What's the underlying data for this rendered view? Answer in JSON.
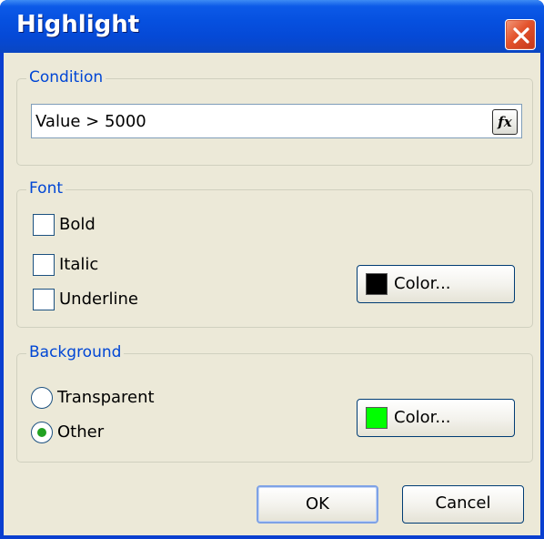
{
  "window": {
    "title": "Highlight"
  },
  "condition": {
    "legend": "Condition",
    "value": "Value > 5000",
    "fx_label": "fx"
  },
  "font": {
    "legend": "Font",
    "checkboxes": [
      {
        "label": "Bold",
        "checked": false
      },
      {
        "label": "Italic",
        "checked": false
      },
      {
        "label": "Underline",
        "checked": false
      }
    ],
    "color_button": {
      "label": "Color...",
      "swatch": "#000000"
    }
  },
  "background": {
    "legend": "Background",
    "options": [
      {
        "label": "Transparent",
        "selected": false
      },
      {
        "label": "Other",
        "selected": true
      }
    ],
    "color_button": {
      "label": "Color...",
      "swatch": "#00ff00"
    }
  },
  "buttons": {
    "ok": "OK",
    "cancel": "Cancel"
  },
  "colors": {
    "title_bar": "#0a57e0",
    "close_button": "#e3532c",
    "dialog_bg": "#ece9d8",
    "group_label": "#0046d5",
    "radio_dot": "#21a121"
  }
}
